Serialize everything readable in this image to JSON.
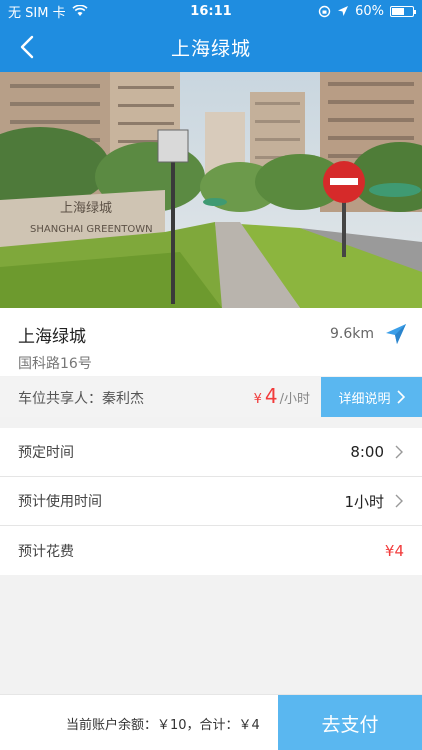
{
  "status_bar": {
    "carrier": "无 SIM 卡",
    "time": "16:11",
    "battery": "60%",
    "battery_level": 0.6
  },
  "nav": {
    "title": "上海绿城"
  },
  "place": {
    "name": "上海绿城",
    "address": "国科路16号",
    "distance": "9.6km"
  },
  "share": {
    "label": "车位共享人：秦利杰",
    "currency": "¥",
    "price": "4",
    "unit": "/小时",
    "detail_button": "详细说明"
  },
  "rows": [
    {
      "label": "预定时间",
      "value": "8:00"
    },
    {
      "label": "预计使用时间",
      "value": "1小时"
    },
    {
      "label": "预计花费",
      "value": "¥4"
    }
  ],
  "bottom": {
    "balance_text": "当前账户余额：￥10，合计：￥4",
    "pay_button": "去支付"
  },
  "colors": {
    "brand_blue": "#1f8de0",
    "button_blue": "#5ab7f0",
    "price_red": "#f23b3b"
  }
}
